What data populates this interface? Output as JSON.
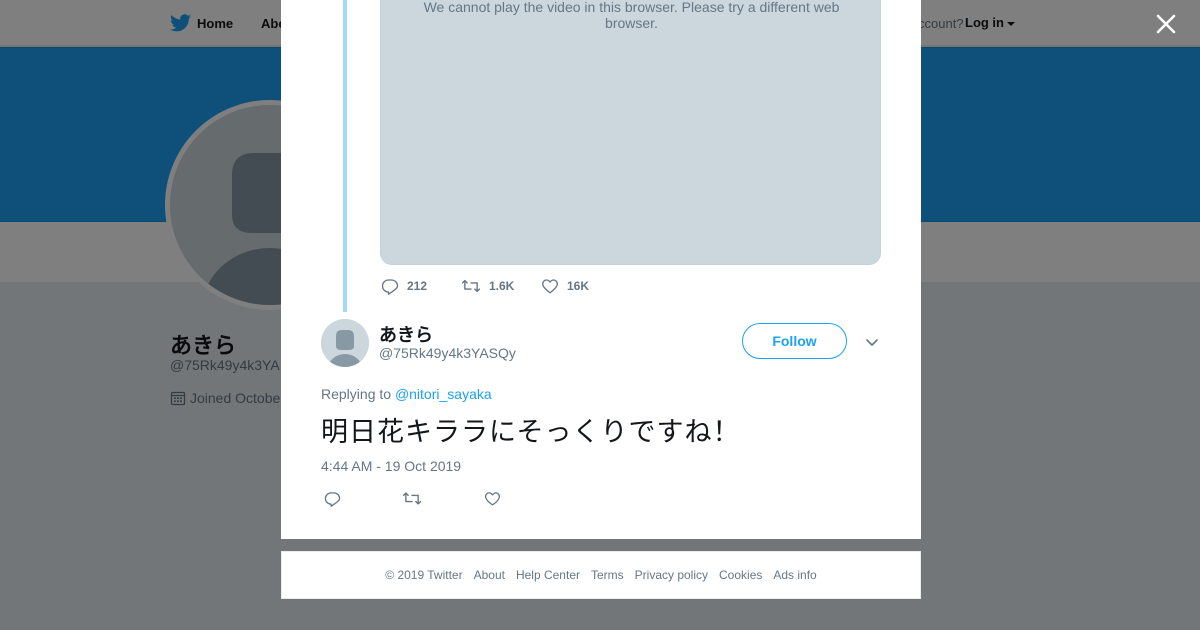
{
  "topbar": {
    "home_label": "Home",
    "about_label_partial": "Abo",
    "have_account_partial": "ccount?",
    "login_label": "Log in"
  },
  "profile": {
    "name": "あきら",
    "handle_partial": "@75Rk49y4k3YA",
    "joined_partial": "Joined Octobe"
  },
  "modal": {
    "video_message": "We cannot play the video in this browser. Please try a different web browser.",
    "original_tweet_stats": {
      "replies": "212",
      "retweets": "1.6K",
      "likes": "16K"
    },
    "reply": {
      "display_name": "あきら",
      "handle": "@75Rk49y4k3YASQy",
      "follow_label": "Follow",
      "replying_prefix": "Replying to",
      "replying_to": "@nitori_sayaka",
      "text": "明日花キララにそっくりですね！",
      "timestamp": "4:44 AM - 19 Oct 2019"
    }
  },
  "footer": {
    "copyright": "© 2019 Twitter",
    "links": [
      "About",
      "Help Center",
      "Terms",
      "Privacy policy",
      "Cookies",
      "Ads info"
    ]
  },
  "colors": {
    "accent": "#1da1f2",
    "thread_line": "#a5d9f9",
    "muted_text": "#657786",
    "video_placeholder": "#ccd6dd"
  },
  "icons": {
    "close": "close-icon",
    "logo": "twitter-bird-icon",
    "reply": "reply-icon",
    "retweet": "retweet-icon",
    "like": "heart-icon",
    "more": "chevron-down-icon",
    "calendar": "calendar-icon"
  }
}
